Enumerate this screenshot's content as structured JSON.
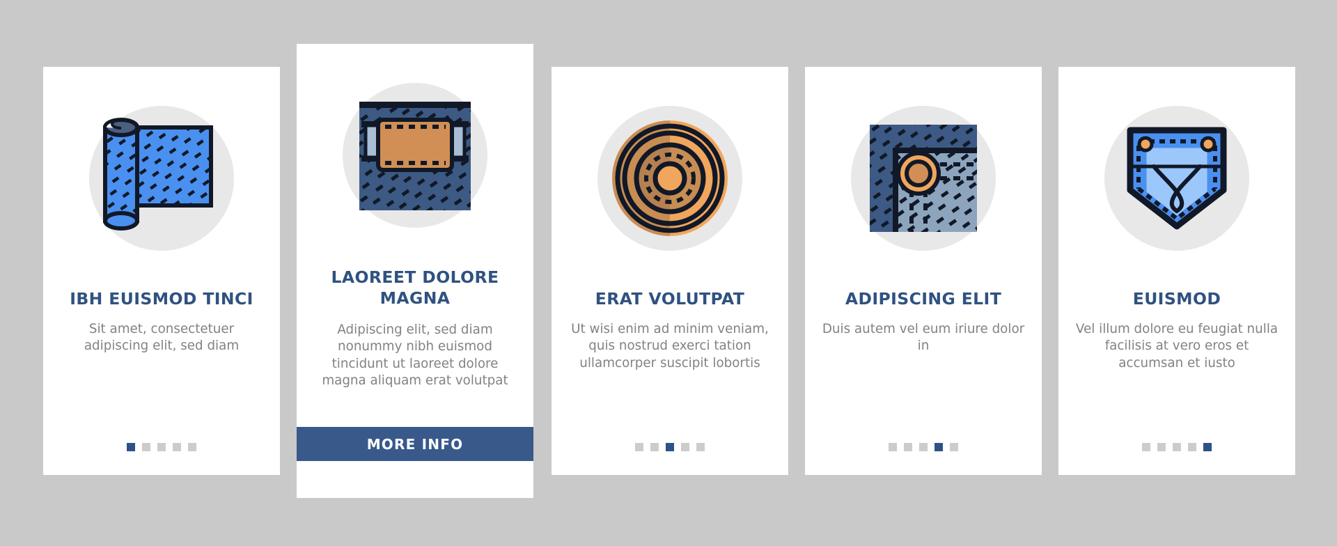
{
  "page": {
    "background_color": "#c9c9c9",
    "card_background": "#ffffff",
    "accent_color": "#2f5280",
    "button_color": "#38598a",
    "body_text_color": "#808285",
    "dot_inactive_color": "#cccccc",
    "dot_active_color": "#2d5288",
    "icon_circle_color": "#e8e8e8"
  },
  "cards": [
    {
      "id": "card-1",
      "featured": false,
      "icon_name": "fabric-roll-icon",
      "title": "IBH EUISMOD TINCI",
      "body": "Sit amet, consectetuer adipiscing elit, sed diam",
      "dots": {
        "total": 5,
        "active_index": 1
      }
    },
    {
      "id": "card-2",
      "featured": true,
      "icon_name": "denim-patch-label-icon",
      "title": "LAOREET DOLORE MAGNA",
      "body": "Adipiscing elit, sed diam nonummy nibh euismod tincidunt ut laoreet dolore magna aliquam erat volutpat",
      "button_label": "MORE INFO"
    },
    {
      "id": "card-3",
      "featured": false,
      "icon_name": "thread-spool-spiral-icon",
      "title": "ERAT VOLUTPAT",
      "body": "Ut wisi enim ad minim veniam, quis nostrud exerci tation ullamcorper suscipit lobortis",
      "dots": {
        "total": 5,
        "active_index": 3
      }
    },
    {
      "id": "card-4",
      "featured": false,
      "icon_name": "denim-rivet-button-icon",
      "title": "ADIPISCING ELIT",
      "body": "Duis autem vel eum iriure dolor in",
      "dots": {
        "total": 5,
        "active_index": 4
      }
    },
    {
      "id": "card-5",
      "featured": false,
      "icon_name": "jeans-pocket-drop-icon",
      "title": "EUISMOD",
      "body": "Vel illum dolore eu feugiat nulla facilisis at vero eros et accumsan et iusto",
      "dots": {
        "total": 5,
        "active_index": 5
      }
    }
  ]
}
